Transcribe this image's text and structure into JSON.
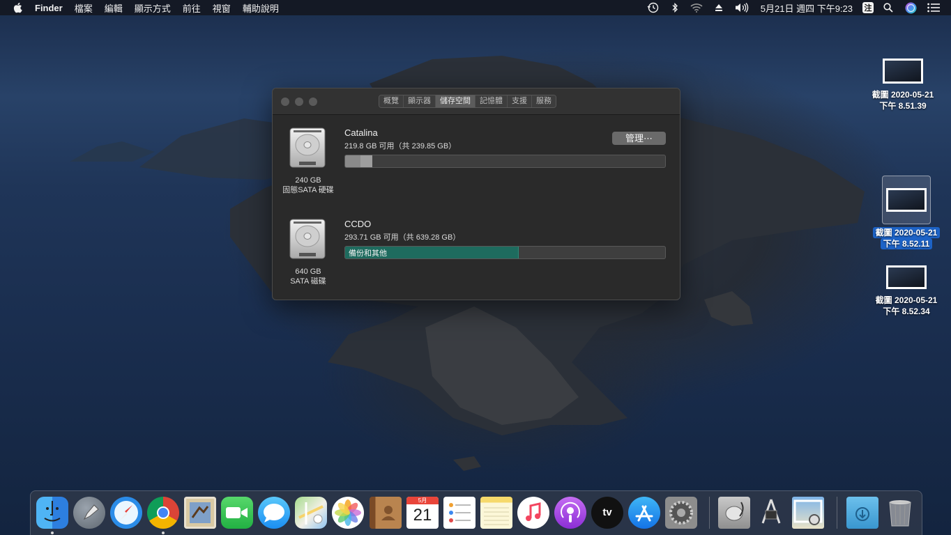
{
  "menubar": {
    "app_name": "Finder",
    "menus": [
      "檔案",
      "編輯",
      "顯示方式",
      "前往",
      "視窗",
      "輔助說明"
    ],
    "clock": "5月21日 週四 下午9:23",
    "input_method": "注"
  },
  "window": {
    "tabs": [
      "概覽",
      "顯示器",
      "儲存空間",
      "記憶體",
      "支援",
      "服務"
    ],
    "active_tab": "儲存空間",
    "manage_button": "管理⋯",
    "drives": [
      {
        "name": "Catalina",
        "free_text": "219.8 GB 可用（共 239.85 GB）",
        "capacity": "240 GB",
        "type": "固態SATA 硬碟",
        "used_fraction": 0.084
      },
      {
        "name": "CCDO",
        "free_text": "293.71 GB 可用（共 639.28 GB）",
        "capacity": "640 GB",
        "type": "SATA 磁碟",
        "used_fraction": 0.54,
        "segment_label": "備份和其他"
      }
    ]
  },
  "desktop_icons": [
    {
      "line1": "截圖 2020-05-21",
      "line2": "下午 8.51.39",
      "selected": false
    },
    {
      "line1": "截圖 2020-05-21",
      "line2": "下午 8.52.11",
      "selected": true
    },
    {
      "line1": "截圖 2020-05-21",
      "line2": "下午 8.52.34",
      "selected": false
    }
  ],
  "dock": {
    "calendar_month": "5月",
    "calendar_day": "21",
    "tv_label": "tv",
    "apps": [
      "Finder",
      "Launchpad",
      "Safari",
      "Chrome",
      "Mail",
      "FaceTime",
      "Messages",
      "Maps",
      "Photos",
      "Contacts",
      "Calendar",
      "Reminders",
      "Notes",
      "Music",
      "Podcasts",
      "TV",
      "App Store",
      "System Preferences",
      "Disk Utility",
      "System Information",
      "Preview",
      "Downloads",
      "Trash"
    ]
  },
  "colors": {
    "menubar_bg": "#141822",
    "accent_selection": "#1d63c7",
    "backup_segment": "#1e6b5e"
  }
}
